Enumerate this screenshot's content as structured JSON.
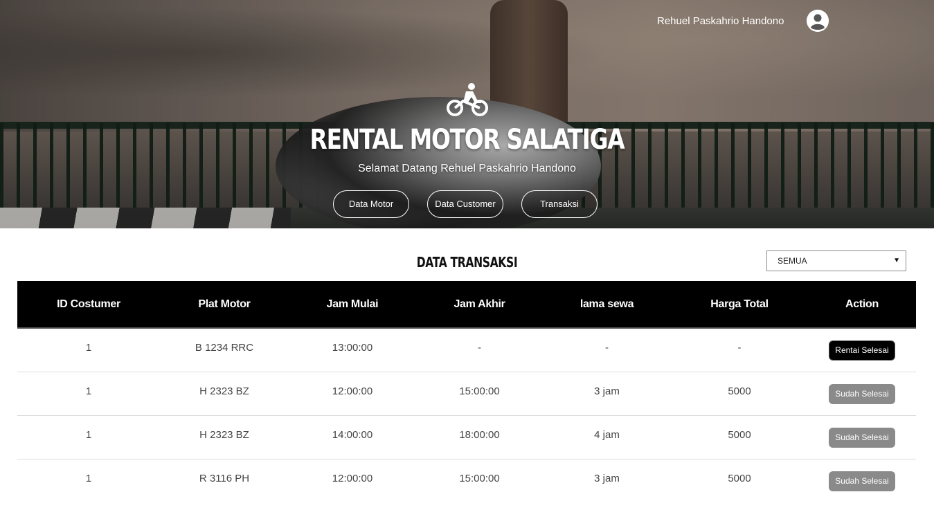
{
  "header": {
    "user_name": "Rehuel Paskahrio Handono",
    "brand_title": "RENTAL MOTOR SALATIGA",
    "welcome": "Selamat Datang Rehuel Paskahrio Handono",
    "nav": [
      {
        "label": "Data Motor"
      },
      {
        "label": "Data Customer"
      },
      {
        "label": "Transaksi"
      }
    ]
  },
  "section": {
    "title": "DATA TRANSAKSI",
    "filter_selected": "SEMUA"
  },
  "table": {
    "columns": [
      "ID Costumer",
      "Plat Motor",
      "Jam Mulai",
      "Jam Akhir",
      "lama sewa",
      "Harga Total",
      "Action"
    ],
    "rows": [
      {
        "id": "1",
        "plat": "B 1234 RRC",
        "mulai": "13:00:00",
        "akhir": "-",
        "lama": "-",
        "harga": "-",
        "action": "Rentai Selesai",
        "action_style": "black"
      },
      {
        "id": "1",
        "plat": "H 2323 BZ",
        "mulai": "12:00:00",
        "akhir": "15:00:00",
        "lama": "3 jam",
        "harga": "5000",
        "action": "Sudah Selesai",
        "action_style": "gray"
      },
      {
        "id": "1",
        "plat": "H 2323 BZ",
        "mulai": "14:00:00",
        "akhir": "18:00:00",
        "lama": "4 jam",
        "harga": "5000",
        "action": "Sudah Selesai",
        "action_style": "gray"
      },
      {
        "id": "1",
        "plat": "R 3116 PH",
        "mulai": "12:00:00",
        "akhir": "15:00:00",
        "lama": "3 jam",
        "harga": "5000",
        "action": "Sudah Selesai",
        "action_style": "gray"
      }
    ]
  },
  "icons": {
    "brand": "motorcycle-rider-icon",
    "user": "user-circle-icon",
    "filter_caret": "caret-down-icon"
  },
  "colors": {
    "table_header_bg": "#000000",
    "action_active": "#000000",
    "action_done": "#8a8a8a"
  }
}
